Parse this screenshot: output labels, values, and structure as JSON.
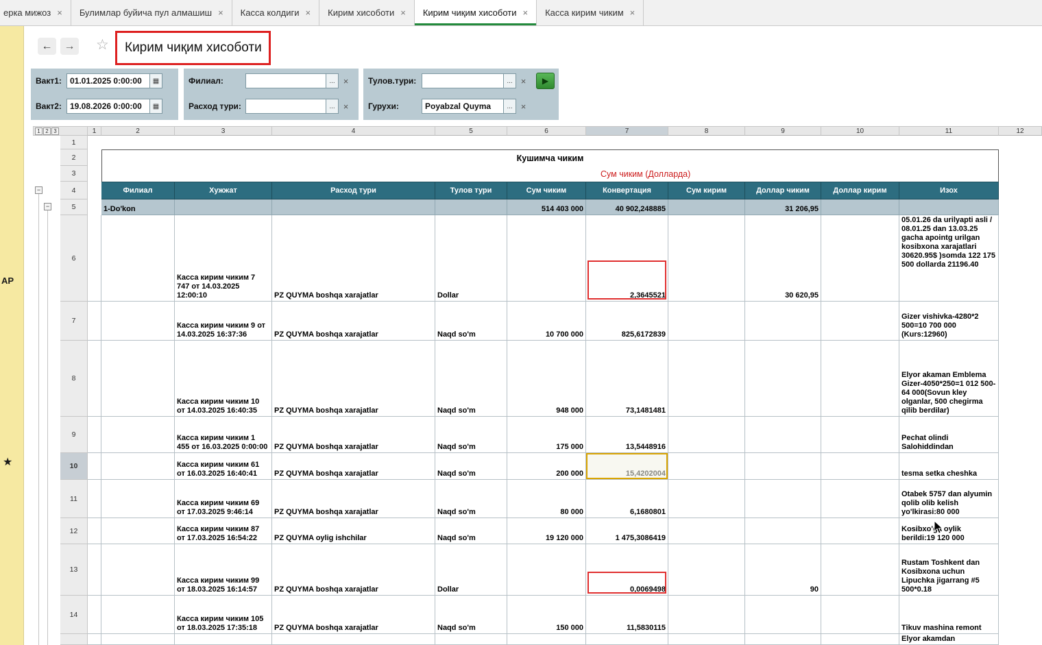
{
  "side": {
    "label": "АР",
    "star": "★"
  },
  "tabs": {
    "close": "×",
    "items": [
      {
        "label": "ерка мижоз"
      },
      {
        "label": "Булимлар буйича пул алмашиш"
      },
      {
        "label": "Касса колдиги"
      },
      {
        "label": "Кирим хисоботи"
      },
      {
        "label": "Кирим чиқим хисоботи"
      },
      {
        "label": "Касса кирим чиким"
      }
    ]
  },
  "toolbar": {
    "back": "←",
    "forward": "→",
    "star": "☆",
    "title": "Кирим чиқим хисоботи"
  },
  "filters": {
    "vakt1_label": "Вакт1:",
    "vakt1_value": "01.01.2025  0:00:00",
    "vakt2_label": "Вакт2:",
    "vakt2_value": "19.08.2026  0:00:00",
    "filial_label": "Филиал:",
    "filial_value": "",
    "rasxod_label": "Расход тури:",
    "rasxod_value": "",
    "tulov_label": "Тулов.тури:",
    "tulov_value": "",
    "guruh_label": "Гурухи:",
    "guruh_value": "Poyabzal Quyma",
    "more": "...",
    "clear": "×",
    "calendar": "▦",
    "run": "▶"
  },
  "grid": {
    "group_buttons": [
      "1",
      "2",
      "3"
    ],
    "collapse": "−",
    "col_headers": [
      "1",
      "2",
      "3",
      "4",
      "5",
      "6",
      "7",
      "8",
      "9",
      "10",
      "11",
      "12"
    ],
    "row_nums_top": [
      "1",
      "2",
      "3",
      "4",
      "5"
    ],
    "report_title": "Кушимча чиким",
    "report_subtitle": "Сум чиким (Долларда)",
    "headers": {
      "filial": "Филиал",
      "doc": "Хужжат",
      "rasxod": "Расход тури",
      "tulov": "Тулов тури",
      "sum": "Сум чиким",
      "konv": "Конвертация",
      "kirim": "Сум кирим",
      "dchiqim": "Доллар чиким",
      "dkirim": "Доллар кирим",
      "izoh": "Изох"
    },
    "summary": {
      "filial": "1-Do'kon",
      "sum": "514 403 000",
      "konv": "40 902,248885",
      "dchiqim": "31 206,95"
    },
    "rows": [
      {
        "n": "6",
        "doc": "Касса кирим чиким 7 747 от 14.03.2025 12:00:10",
        "rasxod": "PZ QUYMA boshqa xarajatlar",
        "tulov": "Dollar",
        "sum": "",
        "konv": "2,3645521",
        "kirim": "",
        "dchiqim": "30 620,95",
        "dkirim": "",
        "izoh": "05.01.26 da urilyapti asli / 08.01.25 dan 13.03.25 gacha apointg urilgan kosibxona xarajatlari 30620.95$ )somda 122 175 500 dollarda 21196.40"
      },
      {
        "n": "7",
        "doc": "Касса кирим чиким 9 от 14.03.2025 16:37:36",
        "rasxod": "PZ QUYMA boshqa xarajatlar",
        "tulov": "Naqd so'm",
        "sum": "10 700 000",
        "konv": "825,6172839",
        "kirim": "",
        "dchiqim": "",
        "dkirim": "",
        "izoh": "Gizer vishivka-4280*2 500=10 700 000 (Kurs:12960)"
      },
      {
        "n": "8",
        "doc": "Касса кирим чиким 10 от 14.03.2025 16:40:35",
        "rasxod": "PZ QUYMA boshqa xarajatlar",
        "tulov": "Naqd so'm",
        "sum": "948 000",
        "konv": "73,1481481",
        "kirim": "",
        "dchiqim": "",
        "dkirim": "",
        "izoh": "Elyor akaman Emblema Gizer-4050*250=1 012 500-64 000(Sovun kley olganlar, 500 chegirma qilib berdilar)"
      },
      {
        "n": "9",
        "doc": "Касса кирим чиким 1 455 от 16.03.2025 0:00:00",
        "rasxod": "PZ QUYMA boshqa xarajatlar",
        "tulov": "Naqd so'm",
        "sum": "175 000",
        "konv": "13,5448916",
        "kirim": "",
        "dchiqim": "",
        "dkirim": "",
        "izoh": "Pechat olindi Salohiddindan"
      },
      {
        "n": "10",
        "doc": "Касса кирим чиким 61 от 16.03.2025 16:40:41",
        "rasxod": "PZ QUYMA boshqa xarajatlar",
        "tulov": "Naqd so'm",
        "sum": "200 000",
        "konv": "15,4202004",
        "kirim": "",
        "dchiqim": "",
        "dkirim": "",
        "izoh": "tesma setka cheshka"
      },
      {
        "n": "11",
        "doc": "Касса кирим чиким 69 от 17.03.2025 9:46:14",
        "rasxod": "PZ QUYMA boshqa xarajatlar",
        "tulov": "Naqd so'm",
        "sum": "80 000",
        "konv": "6,1680801",
        "kirim": "",
        "dchiqim": "",
        "dkirim": "",
        "izoh": "Otabek 5757 dan alyumin qolib olib kelish yo'lkirasi:80 000"
      },
      {
        "n": "12",
        "doc": "Касса кирим чиким 87 от 17.03.2025 16:54:22",
        "rasxod": "PZ QUYMA oylig ishchilar",
        "tulov": "Naqd so'm",
        "sum": "19 120 000",
        "konv": "1 475,3086419",
        "kirim": "",
        "dchiqim": "",
        "dkirim": "",
        "izoh": "Kosibxo'ga oylik berildi:19 120 000"
      },
      {
        "n": "13",
        "doc": "Касса кирим чиким 99 от 18.03.2025 16:14:57",
        "rasxod": "PZ QUYMA boshqa xarajatlar",
        "tulov": "Dollar",
        "sum": "",
        "konv": "0,0069498",
        "kirim": "",
        "dchiqim": "90",
        "dkirim": "",
        "izoh": "Rustam Toshkent dan Kosibxona uchun Lipuchka jigarrang #5 500*0.18"
      },
      {
        "n": "14",
        "doc": "Касса кирим чиким 105 от 18.03.2025 17:35:18",
        "rasxod": "PZ QUYMA boshqa xarajatlar",
        "tulov": "Naqd so'm",
        "sum": "150 000",
        "konv": "11,5830115",
        "kirim": "",
        "dchiqim": "",
        "dkirim": "",
        "izoh": "Tikuv mashina remont"
      }
    ],
    "partial_row": {
      "izoh": "Elyor akamdan"
    }
  }
}
